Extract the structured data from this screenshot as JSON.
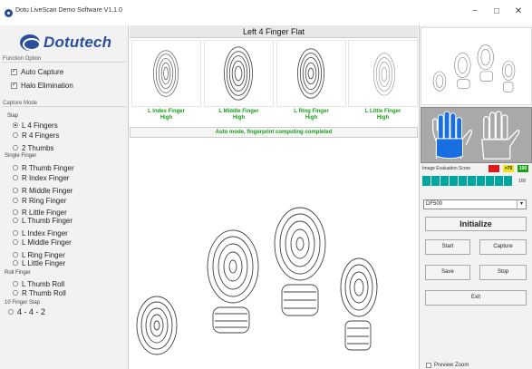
{
  "window": {
    "title": "Dotu LiveScan Demo Software V1.1.0",
    "min_glyph": "−",
    "max_glyph": "□",
    "close_glyph": "✕"
  },
  "brand": {
    "name": "Dotutech",
    "brand_color": "#2c4f9c"
  },
  "function_option": {
    "label": "Function Option",
    "items": [
      {
        "label": "Auto Capture",
        "checked": true
      },
      {
        "label": "Halo Elimination",
        "checked": true
      }
    ]
  },
  "capture_mode": {
    "label": "Capture Mode",
    "slap": {
      "label": "Slap",
      "options": [
        {
          "label": "L 4 Fingers",
          "selected": true
        },
        {
          "label": "R 4 Fingers",
          "selected": false
        },
        {
          "label": "2 Thumbs",
          "selected": false
        }
      ]
    },
    "single_finger": {
      "label": "Single Finger",
      "options": [
        {
          "label": "R Thumb Finger"
        },
        {
          "label": "R Index Finger"
        },
        {
          "label": "R Middle Finger"
        },
        {
          "label": "R Ring Finger"
        },
        {
          "label": "R Little Finger"
        },
        {
          "label": "L Thumb Finger"
        },
        {
          "label": "L Index Finger"
        },
        {
          "label": "L Middle Finger"
        },
        {
          "label": "L Ring Finger"
        },
        {
          "label": "L Little Finger"
        }
      ]
    },
    "roll_finger": {
      "label": "Roll Finger",
      "options": [
        {
          "label": "L Thumb Roll"
        },
        {
          "label": "R Thumb Roll"
        }
      ]
    },
    "ten_finger": {
      "label": "10 Finger Slap",
      "options": [
        {
          "label": "4 - 4 - 2"
        }
      ]
    }
  },
  "center": {
    "mode_title": "Left 4 Finger Flat",
    "fingers": [
      {
        "name": "L Index Finger",
        "score": "High"
      },
      {
        "name": "L Middle Finger",
        "score": "High"
      },
      {
        "name": "L Ring Finger",
        "score": "High"
      },
      {
        "name": "L Little Finger",
        "score": "High"
      }
    ],
    "status": "Auto mode, fingerprint computing completed",
    "status_color": "#1a9c1a"
  },
  "right": {
    "score_label": "Image Evaluation Score",
    "score_chips": [
      {
        "text": "",
        "color": "#e01818"
      },
      {
        "text": ">70",
        "color": "#f2e51a"
      },
      {
        "text": "100",
        "color": "#19a11a"
      }
    ],
    "score_value": 100,
    "score_max_label": "100",
    "score_segments": 10,
    "segment_color": "#00a6a0",
    "device": "DF500",
    "buttons": {
      "initialize": "Initialize",
      "start": "Start",
      "capture": "Capture",
      "save": "Save",
      "stop": "Stop",
      "exit": "Exit"
    },
    "preview_zoom": {
      "label": "Preview Zoom",
      "checked": false
    },
    "hand_highlight_color": "#1a6fe0"
  }
}
